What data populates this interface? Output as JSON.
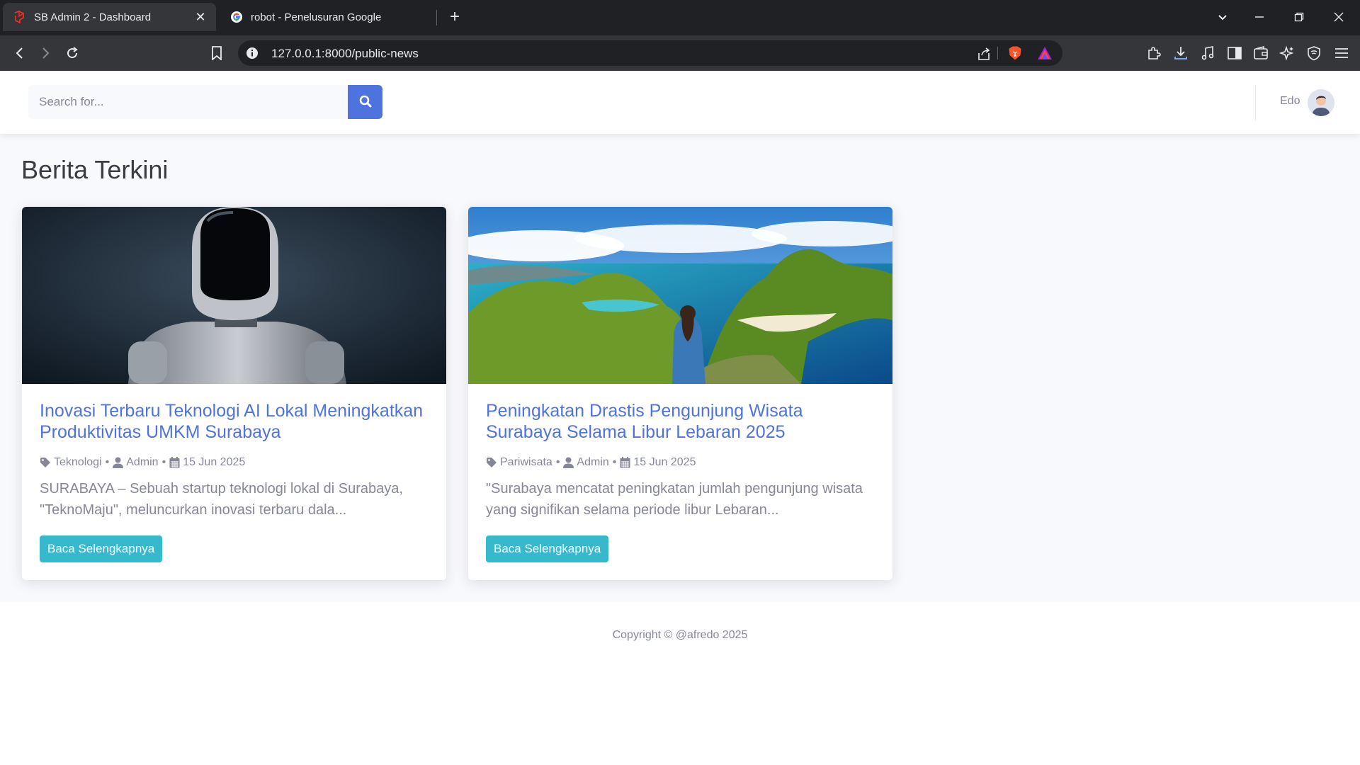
{
  "browser": {
    "tabs": [
      {
        "title": "SB Admin 2 - Dashboard",
        "active": true
      },
      {
        "title": "robot - Penelusuran Google",
        "active": false
      }
    ],
    "url": "127.0.0.1:8000/public-news"
  },
  "topbar": {
    "search_placeholder": "Search for...",
    "user_name": "Edo"
  },
  "page": {
    "heading": "Berita Terkini"
  },
  "articles": [
    {
      "title": "Inovasi Terbaru Teknologi AI Lokal Meningkatkan Produktivitas UMKM Surabaya",
      "category": "Teknologi",
      "author": "Admin",
      "date": "15 Jun 2025",
      "excerpt": "SURABAYA – Sebuah startup teknologi lokal di Surabaya, \"TeknoMaju\", meluncurkan inovasi terbaru dala...",
      "button": "Baca Selengkapnya"
    },
    {
      "title": "Peningkatan Drastis Pengunjung Wisata Surabaya Selama Libur Lebaran 2025",
      "category": "Pariwisata",
      "author": "Admin",
      "date": "15 Jun 2025",
      "excerpt": "\"Surabaya mencatat peningkatan jumlah pengunjung wisata yang signifikan selama periode libur Lebaran...",
      "button": "Baca Selengkapnya"
    }
  ],
  "footer": {
    "copyright": "Copyright © @afredo 2025"
  },
  "colors": {
    "primary": "#4e73df",
    "info": "#36b9cc",
    "muted": "#858796"
  }
}
